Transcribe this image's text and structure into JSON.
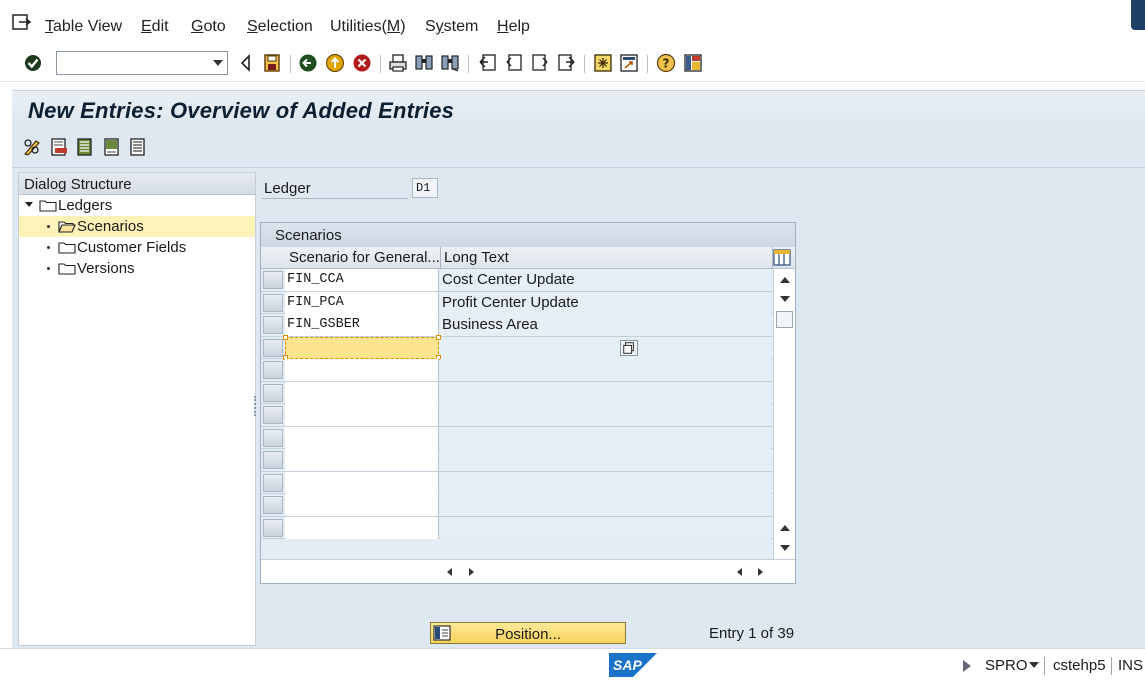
{
  "menubar": {
    "items": [
      {
        "pre": "",
        "u": "T",
        "post": "able View"
      },
      {
        "pre": "",
        "u": "E",
        "post": "dit"
      },
      {
        "pre": "",
        "u": "G",
        "post": "oto"
      },
      {
        "pre": "",
        "u": "S",
        "post": "election"
      },
      {
        "pre": "Utilities(",
        "u": "M",
        "post": ")"
      },
      {
        "pre": "S",
        "u": "y",
        "post": "stem"
      },
      {
        "pre": "",
        "u": "H",
        "post": "elp"
      }
    ]
  },
  "toolbar": {
    "command_value": ""
  },
  "page": {
    "title": "New Entries: Overview of Added Entries"
  },
  "dialog_structure": {
    "header": "Dialog Structure",
    "items": [
      {
        "label": "Ledgers"
      },
      {
        "label": "Scenarios"
      },
      {
        "label": "Customer Fields"
      },
      {
        "label": "Versions"
      }
    ]
  },
  "ledger": {
    "label": "Ledger",
    "value": "D1"
  },
  "table": {
    "title": "Scenarios",
    "columns": [
      "Scenario for General...",
      "Long Text"
    ],
    "rows": [
      {
        "scenario": "FIN_CCA",
        "text": "Cost Center Update"
      },
      {
        "scenario": "FIN_PCA",
        "text": "Profit Center Update"
      },
      {
        "scenario": "FIN_GSBER",
        "text": "Business Area"
      }
    ]
  },
  "footer": {
    "position_label": "Position...",
    "entry_info": "Entry 1 of 39"
  },
  "statusbar": {
    "transaction": "SPRO",
    "server": "cstehp5",
    "mode": "INS",
    "logo": "SAP"
  },
  "colors": {
    "title_bg": "#e3eaf2",
    "selected_row": "#fdf3b8",
    "active_cell": "#fde58f",
    "position_button": "#f9dc72"
  },
  "icons": [
    "exit-icon",
    "enter-check-icon",
    "back-icon",
    "save-icon",
    "green-back-icon",
    "exit-yellow-icon",
    "cancel-icon",
    "print-icon",
    "find-icon",
    "find-next-icon",
    "first-page-icon",
    "previous-page-icon",
    "next-page-icon",
    "last-page-icon",
    "create-session-icon",
    "shortcut-icon",
    "help-icon",
    "layout-icon",
    "pencil-glasses-icon",
    "delete-row-icon",
    "select-all-icon",
    "select-block-icon",
    "deselect-all-icon",
    "folder-icon",
    "column-settings-icon",
    "f4-help-icon",
    "position-icon",
    "sap-logo"
  ]
}
